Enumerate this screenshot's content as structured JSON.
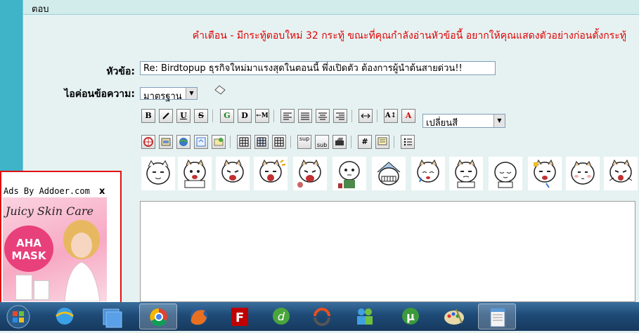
{
  "header": {
    "title": "ตอบ"
  },
  "warning": "คำเตือน - มีกระทู้ตอบใหม่ 32 กระทู้ ขณะที่คุณกำลังอ่านหัวข้อนี้ อยากให้คุณแสดงตัวอย่างก่อนตั้งกระทู้",
  "subject": {
    "label": "หัวข้อ:",
    "value": "Re: Birdtopup ธุรกิจใหม่มาแรงสุดในตอนนี้ พึ่งเปิดตัว ต้องการผู้นำต้นสายด่วน!!"
  },
  "message_icon": {
    "label": "ไอค่อนข้อความ:",
    "selected": "มาตรฐาน"
  },
  "toolbar": {
    "row1": [
      "B",
      "I",
      "U",
      "S",
      "G",
      "D",
      "M",
      "A"
    ],
    "color_select": "เปลี่ยนสี",
    "row2": [
      "sup",
      "sub",
      "#"
    ]
  },
  "ad": {
    "label": "Ads By Addoer.com",
    "close": "x",
    "banner_title": "Juicy Skin Care",
    "banner_product": "AHA MASK"
  },
  "colors": {
    "accent_strip": "#3fb3c7",
    "warning": "#e00000",
    "ad_border": "#e01010"
  }
}
